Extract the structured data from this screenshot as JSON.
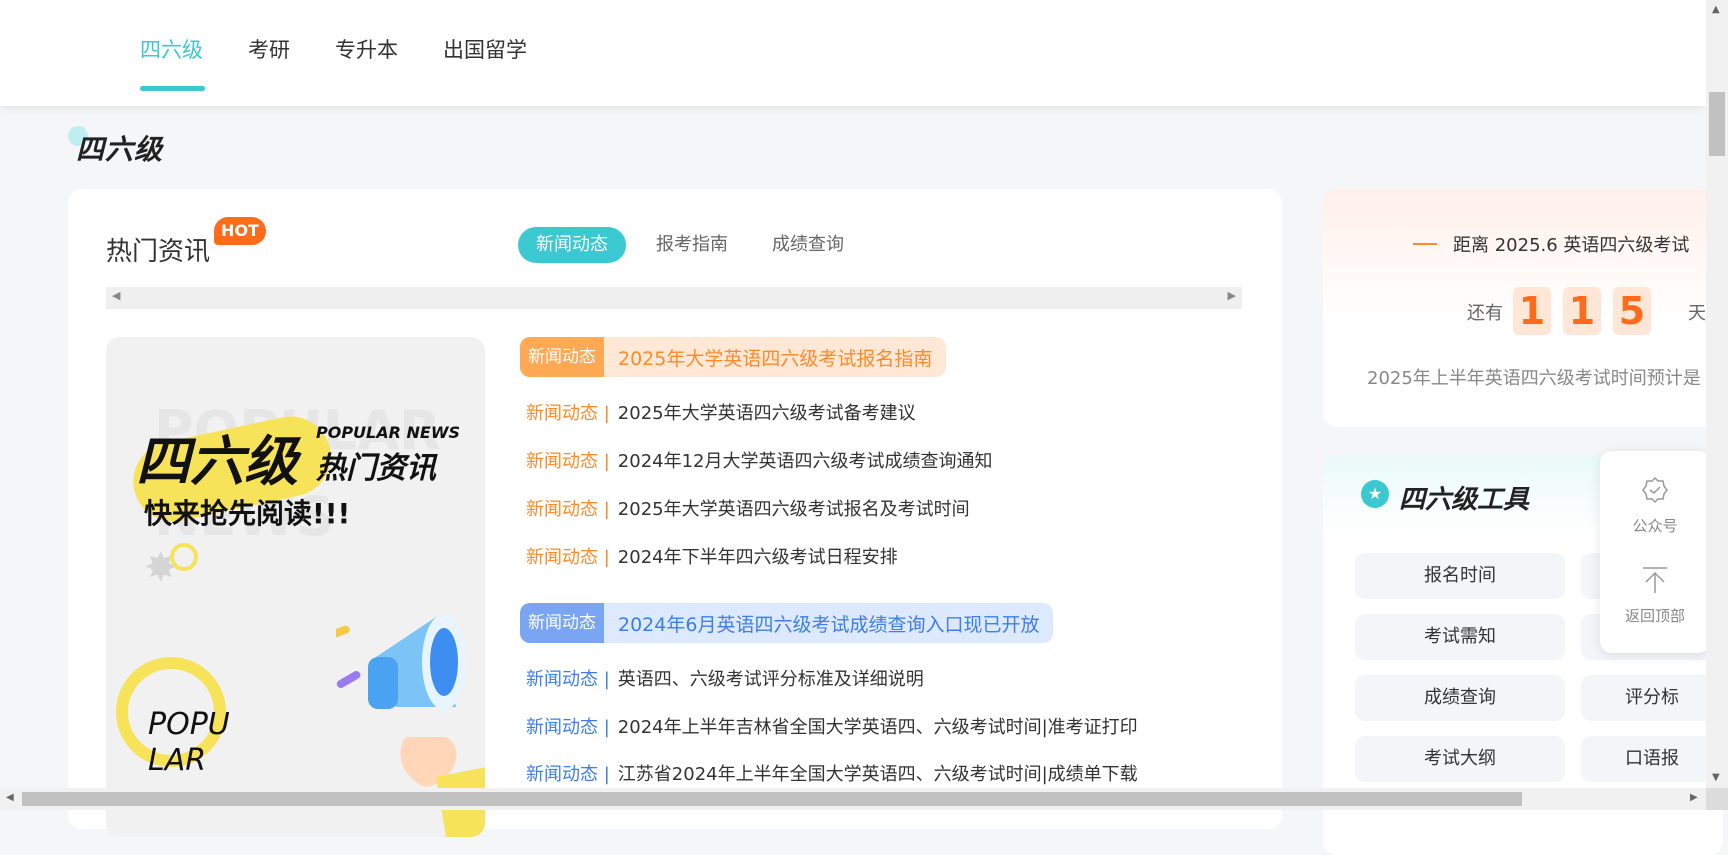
{
  "nav": {
    "tabs": [
      {
        "label": "四六级",
        "active": true
      },
      {
        "label": "考研",
        "active": false
      },
      {
        "label": "专升本",
        "active": false
      },
      {
        "label": "出国留学",
        "active": false
      }
    ]
  },
  "section": {
    "title": "四六级"
  },
  "news": {
    "title": "热门资讯",
    "badge": "HOT",
    "tabs": [
      "新闻动态",
      "报考指南",
      "成绩查询"
    ],
    "promo": {
      "big": "四六级",
      "en": "POPULAR NEWS",
      "cn": "热门资讯",
      "sub": "快来抢先阅读!!!",
      "ghost": "POPULAR",
      "ghost2": "NEWS",
      "popu1": "POPU",
      "popu2": "LAR"
    },
    "headline1": {
      "tag": "新闻动态",
      "text": "2025年大学英语四六级考试报名指南"
    },
    "group1": [
      {
        "cat": "新闻动态 |",
        "text": "2025年大学英语四六级考试备考建议"
      },
      {
        "cat": "新闻动态 |",
        "text": "2024年12月大学英语四六级考试成绩查询通知"
      },
      {
        "cat": "新闻动态 |",
        "text": "2025年大学英语四六级考试报名及考试时间"
      },
      {
        "cat": "新闻动态 |",
        "text": "2024年下半年四六级考试日程安排"
      }
    ],
    "headline2": {
      "tag": "新闻动态",
      "text": "2024年6月英语四六级考试成绩查询入口现已开放"
    },
    "group2": [
      {
        "cat": "新闻动态 |",
        "text": "英语四、六级考试评分标准及详细说明"
      },
      {
        "cat": "新闻动态 |",
        "text": "2024年上半年吉林省全国大学英语四、六级考试时间|准考证打印"
      },
      {
        "cat": "新闻动态 |",
        "text": "江苏省2024年上半年全国大学英语四、六级考试时间|成绩单下载"
      }
    ]
  },
  "countdown": {
    "title": "距离 2025.6 英语四六级考试",
    "left_label": "还有",
    "digits": [
      "1",
      "1",
      "5"
    ],
    "unit": "天",
    "note": "2025年上半年英语四六级考试时间预计是"
  },
  "tools": {
    "title": "四六级工具",
    "buttons": [
      {
        "label": "报名时间"
      },
      {
        "label": ""
      },
      {
        "label": "考试需知"
      },
      {
        "label": ""
      },
      {
        "label": "成绩查询"
      },
      {
        "label": "评分标"
      },
      {
        "label": "考试大纲"
      },
      {
        "label": "口语报"
      }
    ]
  },
  "float_panel": {
    "wechat": "公众号",
    "top": "返回顶部"
  },
  "colors": {
    "accent": "#3cc8d0",
    "orange": "#ff8a2a",
    "blue": "#3d7ee9"
  }
}
